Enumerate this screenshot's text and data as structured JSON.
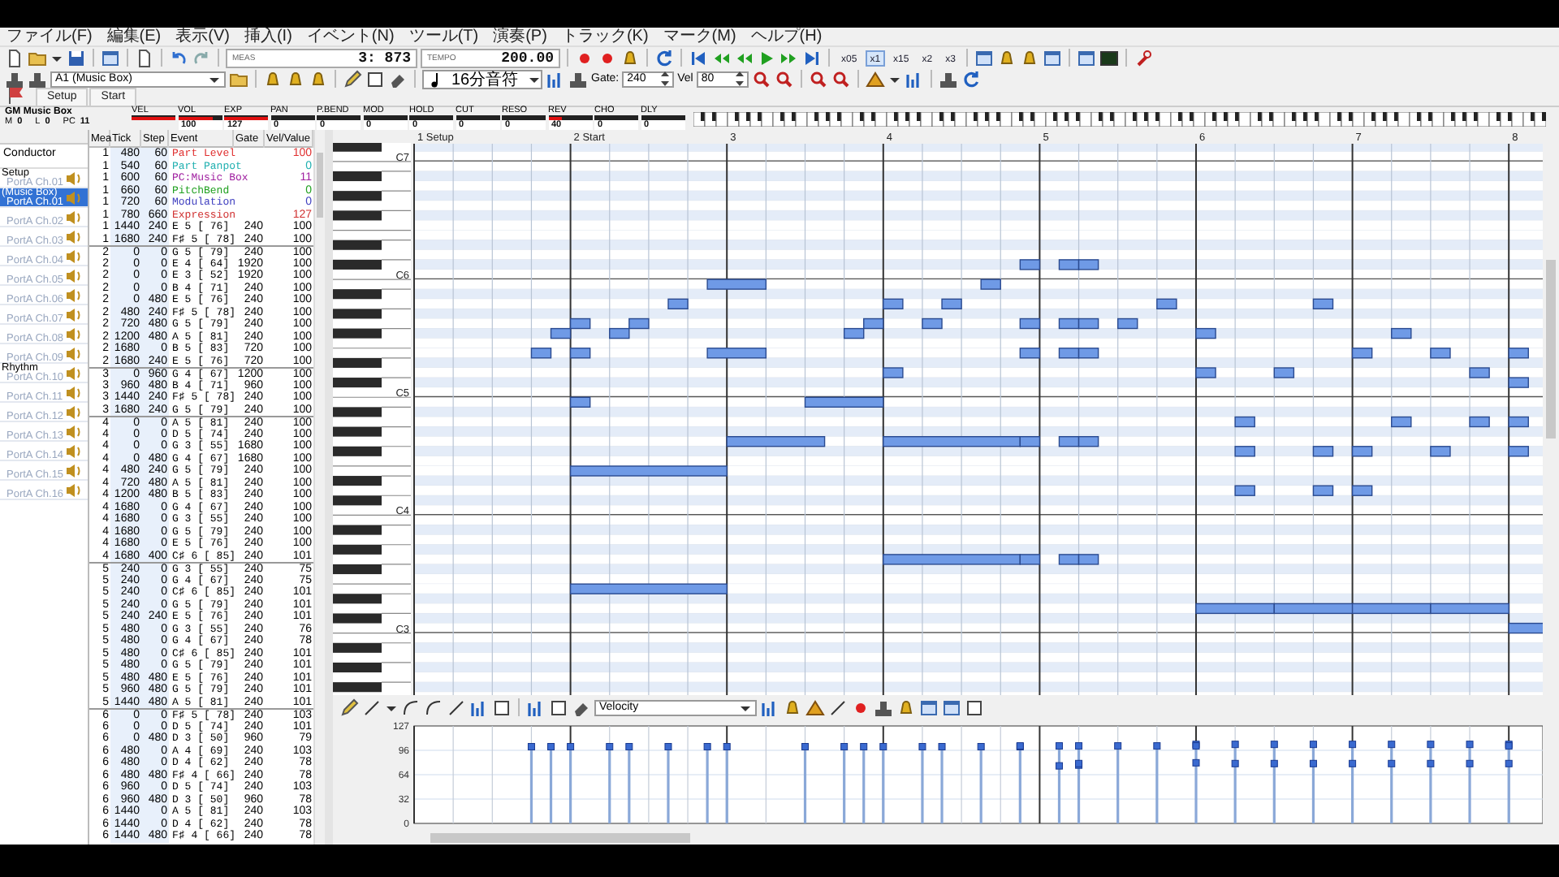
{
  "menu": [
    "ファイル(F)",
    "編集(E)",
    "表示(V)",
    "挿入(I)",
    "イベント(N)",
    "ツール(T)",
    "演奏(P)",
    "トラック(K)",
    "マーク(M)",
    "ヘルプ(H)"
  ],
  "toolbar": {
    "position_label": "MEAS",
    "position": "3: 873",
    "tempo_label": "TEMPO",
    "tempo": "200.00",
    "speeds": [
      {
        "label": "x05",
        "selected": false
      },
      {
        "label": "x1",
        "selected": true
      },
      {
        "label": "x15",
        "selected": false
      },
      {
        "label": "x2",
        "selected": false
      },
      {
        "label": "x3",
        "selected": false
      }
    ],
    "track_select": "A1 (Music Box)",
    "note_length": "16分音符",
    "gate_label": "Gate:",
    "gate": "240",
    "vel_label": "Vel",
    "vel": "80"
  },
  "marker_tabs": [
    {
      "label": "Setup",
      "selected": false
    },
    {
      "label": "Start",
      "selected": false
    }
  ],
  "mixer": {
    "name": "GM Music Box",
    "fields": [
      {
        "label": "M",
        "value": "0"
      },
      {
        "label": "L",
        "value": "0"
      },
      {
        "label": "PC",
        "value": "11"
      }
    ],
    "meters": [
      {
        "label": "VEL",
        "level": 1
      },
      {
        "label": "VOL",
        "value": "100",
        "level": 0.79
      },
      {
        "label": "EXP",
        "value": "127",
        "level": 1
      },
      {
        "label": "PAN",
        "value": "0"
      },
      {
        "label": "P.BEND",
        "value": "0"
      },
      {
        "label": "MOD",
        "value": "0"
      },
      {
        "label": "HOLD",
        "value": "0"
      },
      {
        "label": "CUT",
        "value": "0"
      },
      {
        "label": "RESO",
        "value": "0"
      },
      {
        "label": "REV",
        "value": "40",
        "level": 0.31
      },
      {
        "label": "CHO",
        "value": "0"
      },
      {
        "label": "DLY",
        "value": "0"
      }
    ]
  },
  "tracks": {
    "conductor": "Conductor",
    "items": [
      {
        "name": "Setup",
        "port": "PortA Ch.01",
        "selected": false
      },
      {
        "name": "(Music Box)",
        "port": "PortA Ch.01",
        "selected": true
      },
      {
        "port": "PortA Ch.02",
        "selected": false
      },
      {
        "port": "PortA Ch.03",
        "selected": false
      },
      {
        "port": "PortA Ch.04",
        "selected": false
      },
      {
        "port": "PortA Ch.05",
        "selected": false
      },
      {
        "port": "PortA Ch.06",
        "selected": false
      },
      {
        "port": "PortA Ch.07",
        "selected": false
      },
      {
        "port": "PortA Ch.08",
        "selected": false
      },
      {
        "port": "PortA Ch.09",
        "selected": false
      },
      {
        "name": "Rhythm",
        "port": "PortA Ch.10",
        "selected": false
      },
      {
        "port": "PortA Ch.11",
        "selected": false
      },
      {
        "port": "PortA Ch.12",
        "selected": false
      },
      {
        "port": "PortA Ch.13",
        "selected": false
      },
      {
        "port": "PortA Ch.14",
        "selected": false
      },
      {
        "port": "PortA Ch.15",
        "selected": false
      },
      {
        "port": "PortA Ch.16",
        "selected": false
      }
    ]
  },
  "event_list": {
    "columns": [
      "Mea",
      "Tick",
      "Step",
      "Event",
      "Gate",
      "Vel/Value"
    ],
    "rows": [
      {
        "mea": "1",
        "tick": "480",
        "step": "60",
        "event": "Part Level",
        "value": "100",
        "color": "#e03030"
      },
      {
        "mea": "1",
        "tick": "540",
        "step": "60",
        "event": "Part Panpot",
        "value": "0",
        "color": "#20b0b0"
      },
      {
        "mea": "1",
        "tick": "600",
        "step": "60",
        "event": "PC:Music Box",
        "value": "11",
        "color": "#a020a0"
      },
      {
        "mea": "1",
        "tick": "660",
        "step": "60",
        "event": "PitchBend",
        "value": "0",
        "color": "#20a020"
      },
      {
        "mea": "1",
        "tick": "720",
        "step": "60",
        "event": "Modulation",
        "value": "0",
        "color": "#4040c0"
      },
      {
        "mea": "1",
        "tick": "780",
        "step": "660",
        "event": "Expression",
        "value": "127",
        "color": "#d03030"
      },
      {
        "mea": "1",
        "tick": "1440",
        "step": "240",
        "event": "E 5 [ 76]",
        "gate": "240",
        "value": "100"
      },
      {
        "mea": "1",
        "tick": "1680",
        "step": "240",
        "event": "F♯ 5 [ 78]",
        "gate": "240",
        "value": "100"
      },
      {
        "mea": "2",
        "tick": "0",
        "step": "0",
        "event": "G 5 [ 79]",
        "gate": "240",
        "value": "100"
      },
      {
        "mea": "2",
        "tick": "0",
        "step": "0",
        "event": "E 4 [ 64]",
        "gate": "1920",
        "value": "100"
      },
      {
        "mea": "2",
        "tick": "0",
        "step": "0",
        "event": "E 3 [ 52]",
        "gate": "1920",
        "value": "100"
      },
      {
        "mea": "2",
        "tick": "0",
        "step": "0",
        "event": "B 4 [ 71]",
        "gate": "240",
        "value": "100"
      },
      {
        "mea": "2",
        "tick": "0",
        "step": "480",
        "event": "E 5 [ 76]",
        "gate": "240",
        "value": "100"
      },
      {
        "mea": "2",
        "tick": "480",
        "step": "240",
        "event": "F♯ 5 [ 78]",
        "gate": "240",
        "value": "100"
      },
      {
        "mea": "2",
        "tick": "720",
        "step": "480",
        "event": "G 5 [ 79]",
        "gate": "240",
        "value": "100"
      },
      {
        "mea": "2",
        "tick": "1200",
        "step": "480",
        "event": "A 5 [ 81]",
        "gate": "240",
        "value": "100"
      },
      {
        "mea": "2",
        "tick": "1680",
        "step": "0",
        "event": "B 5 [ 83]",
        "gate": "720",
        "value": "100"
      },
      {
        "mea": "2",
        "tick": "1680",
        "step": "240",
        "event": "E 5 [ 76]",
        "gate": "720",
        "value": "100"
      },
      {
        "mea": "3",
        "tick": "0",
        "step": "960",
        "event": "G 4 [ 67]",
        "gate": "1200",
        "value": "100"
      },
      {
        "mea": "3",
        "tick": "960",
        "step": "480",
        "event": "B 4 [ 71]",
        "gate": "960",
        "value": "100"
      },
      {
        "mea": "3",
        "tick": "1440",
        "step": "240",
        "event": "F♯ 5 [ 78]",
        "gate": "240",
        "value": "100"
      },
      {
        "mea": "3",
        "tick": "1680",
        "step": "240",
        "event": "G 5 [ 79]",
        "gate": "240",
        "value": "100"
      },
      {
        "mea": "4",
        "tick": "0",
        "step": "0",
        "event": "A 5 [ 81]",
        "gate": "240",
        "value": "100"
      },
      {
        "mea": "4",
        "tick": "0",
        "step": "0",
        "event": "D 5 [ 74]",
        "gate": "240",
        "value": "100"
      },
      {
        "mea": "4",
        "tick": "0",
        "step": "0",
        "event": "G 3 [ 55]",
        "gate": "1680",
        "value": "100"
      },
      {
        "mea": "4",
        "tick": "0",
        "step": "480",
        "event": "G 4 [ 67]",
        "gate": "1680",
        "value": "100"
      },
      {
        "mea": "4",
        "tick": "480",
        "step": "240",
        "event": "G 5 [ 79]",
        "gate": "240",
        "value": "100"
      },
      {
        "mea": "4",
        "tick": "720",
        "step": "480",
        "event": "A 5 [ 81]",
        "gate": "240",
        "value": "100"
      },
      {
        "mea": "4",
        "tick": "1200",
        "step": "480",
        "event": "B 5 [ 83]",
        "gate": "240",
        "value": "100"
      },
      {
        "mea": "4",
        "tick": "1680",
        "step": "0",
        "event": "G 4 [ 67]",
        "gate": "240",
        "value": "100"
      },
      {
        "mea": "4",
        "tick": "1680",
        "step": "0",
        "event": "G 3 [ 55]",
        "gate": "240",
        "value": "100"
      },
      {
        "mea": "4",
        "tick": "1680",
        "step": "0",
        "event": "G 5 [ 79]",
        "gate": "240",
        "value": "100"
      },
      {
        "mea": "4",
        "tick": "1680",
        "step": "0",
        "event": "E 5 [ 76]",
        "gate": "240",
        "value": "100"
      },
      {
        "mea": "4",
        "tick": "1680",
        "step": "400",
        "event": "C♯ 6 [ 85]",
        "gate": "240",
        "value": "101"
      },
      {
        "mea": "5",
        "tick": "240",
        "step": "0",
        "event": "G 3 [ 55]",
        "gate": "240",
        "value": "75"
      },
      {
        "mea": "5",
        "tick": "240",
        "step": "0",
        "event": "G 4 [ 67]",
        "gate": "240",
        "value": "75"
      },
      {
        "mea": "5",
        "tick": "240",
        "step": "0",
        "event": "C♯ 6 [ 85]",
        "gate": "240",
        "value": "101"
      },
      {
        "mea": "5",
        "tick": "240",
        "step": "0",
        "event": "G 5 [ 79]",
        "gate": "240",
        "value": "101"
      },
      {
        "mea": "5",
        "tick": "240",
        "step": "240",
        "event": "E 5 [ 76]",
        "gate": "240",
        "value": "101"
      },
      {
        "mea": "5",
        "tick": "480",
        "step": "0",
        "event": "G 3 [ 55]",
        "gate": "240",
        "value": "76"
      },
      {
        "mea": "5",
        "tick": "480",
        "step": "0",
        "event": "G 4 [ 67]",
        "gate": "240",
        "value": "78"
      },
      {
        "mea": "5",
        "tick": "480",
        "step": "0",
        "event": "C♯ 6 [ 85]",
        "gate": "240",
        "value": "101"
      },
      {
        "mea": "5",
        "tick": "480",
        "step": "0",
        "event": "G 5 [ 79]",
        "gate": "240",
        "value": "101"
      },
      {
        "mea": "5",
        "tick": "480",
        "step": "480",
        "event": "E 5 [ 76]",
        "gate": "240",
        "value": "101"
      },
      {
        "mea": "5",
        "tick": "960",
        "step": "480",
        "event": "G 5 [ 79]",
        "gate": "240",
        "value": "101"
      },
      {
        "mea": "5",
        "tick": "1440",
        "step": "480",
        "event": "A 5 [ 81]",
        "gate": "240",
        "value": "101"
      },
      {
        "mea": "6",
        "tick": "0",
        "step": "0",
        "event": "F♯ 5 [ 78]",
        "gate": "240",
        "value": "103"
      },
      {
        "mea": "6",
        "tick": "0",
        "step": "0",
        "event": "D 5 [ 74]",
        "gate": "240",
        "value": "101"
      },
      {
        "mea": "6",
        "tick": "0",
        "step": "480",
        "event": "D 3 [ 50]",
        "gate": "960",
        "value": "79"
      },
      {
        "mea": "6",
        "tick": "480",
        "step": "0",
        "event": "A 4 [ 69]",
        "gate": "240",
        "value": "103"
      },
      {
        "mea": "6",
        "tick": "480",
        "step": "0",
        "event": "D 4 [ 62]",
        "gate": "240",
        "value": "78"
      },
      {
        "mea": "6",
        "tick": "480",
        "step": "480",
        "event": "F♯ 4 [ 66]",
        "gate": "240",
        "value": "78"
      },
      {
        "mea": "6",
        "tick": "960",
        "step": "0",
        "event": "D 5 [ 74]",
        "gate": "240",
        "value": "103"
      },
      {
        "mea": "6",
        "tick": "960",
        "step": "480",
        "event": "D 3 [ 50]",
        "gate": "960",
        "value": "78"
      },
      {
        "mea": "6",
        "tick": "1440",
        "step": "0",
        "event": "A 5 [ 81]",
        "gate": "240",
        "value": "103"
      },
      {
        "mea": "6",
        "tick": "1440",
        "step": "0",
        "event": "D 4 [ 62]",
        "gate": "240",
        "value": "78"
      },
      {
        "mea": "6",
        "tick": "1440",
        "step": "480",
        "event": "F♯ 4 [ 66]",
        "gate": "240",
        "value": "78"
      }
    ]
  },
  "piano_roll": {
    "measures": [
      "1 Setup",
      "2 Start",
      "3",
      "4",
      "5",
      "6",
      "7",
      "8"
    ],
    "octaves": [
      "C7",
      "C6",
      "C5",
      "C4",
      "C3"
    ]
  },
  "velocity_pane": {
    "parameter": "Velocity",
    "axis_labels": [
      "127",
      "96",
      "64",
      "32",
      "0"
    ]
  }
}
